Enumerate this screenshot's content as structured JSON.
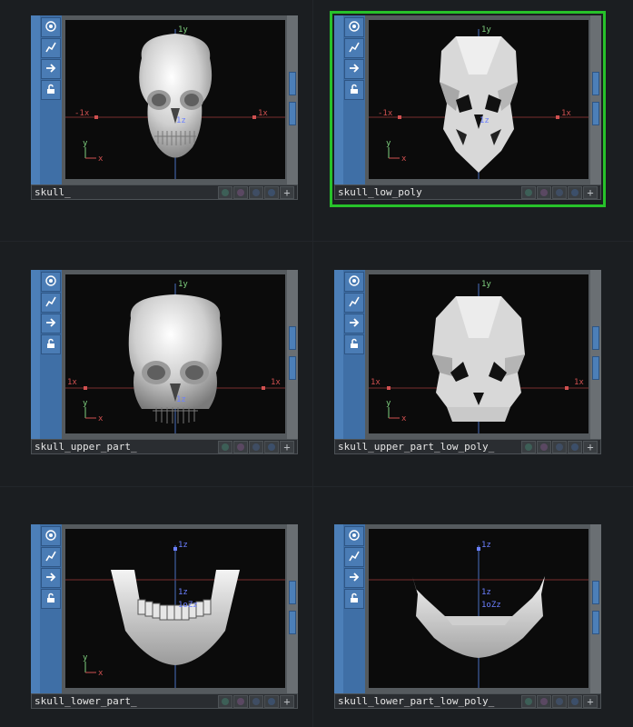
{
  "canvas": {
    "background": "#1b1e21",
    "selection_color": "#27c22a"
  },
  "viewport_labels": {
    "y_axis": "1y",
    "x_neg": "-1x",
    "x_pos": "1x",
    "x_side": "1x",
    "z": "1z",
    "z_small": "1z",
    "z_small2": "1oZz",
    "gizmo_y": "y",
    "gizmo_x": "x"
  },
  "node_icons": [
    "viewer-toggle-icon",
    "graph-icon",
    "arrow-right-icon",
    "lock-icon"
  ],
  "nodes": [
    {
      "name": "skull_",
      "selected": false,
      "model": "skull-high",
      "view": "front"
    },
    {
      "name": "skull_low_poly",
      "selected": true,
      "model": "skull-low",
      "view": "front"
    },
    {
      "name": "skull_upper_part_",
      "selected": false,
      "model": "upper-high",
      "view": "front"
    },
    {
      "name": "skull_upper_part_low_poly_",
      "selected": false,
      "model": "upper-low",
      "view": "front"
    },
    {
      "name": "skull_lower_part_",
      "selected": false,
      "model": "lower-high",
      "view": "top"
    },
    {
      "name": "skull_lower_part_low_poly_",
      "selected": false,
      "model": "lower-low",
      "view": "top"
    }
  ]
}
